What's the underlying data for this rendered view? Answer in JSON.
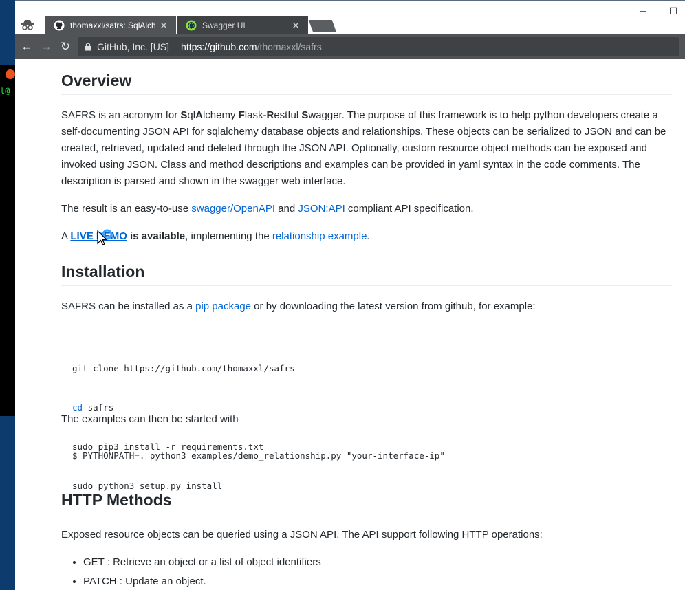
{
  "tabs": [
    {
      "title": "thomaxxl/safrs: SqlAlchem",
      "active": true,
      "icon": "github-icon"
    },
    {
      "title": "Swagger UI",
      "active": false,
      "icon": "swagger-icon"
    }
  ],
  "address": {
    "security_label": "GitHub, Inc. [US]",
    "scheme_host": "https://github.com",
    "path": "/thomaxxl/safrs"
  },
  "overview": {
    "heading": "Overview",
    "para1": [
      {
        "t": "SAFRS is an acronym for "
      },
      {
        "t": "S",
        "b": true
      },
      {
        "t": "ql"
      },
      {
        "t": "A",
        "b": true
      },
      {
        "t": "lchemy "
      },
      {
        "t": "F",
        "b": true
      },
      {
        "t": "lask-"
      },
      {
        "t": "R",
        "b": true
      },
      {
        "t": "estful "
      },
      {
        "t": "S",
        "b": true
      },
      {
        "t": "wagger. The purpose of this framework is to help python developers create a self-documenting JSON API for sqlalchemy database objects and relationships. These objects can be serialized to JSON and can be created, retrieved, updated and deleted through the JSON API. Optionally, custom resource object methods can be exposed and invoked using JSON. Class and method descriptions and examples can be provided in yaml syntax in the code comments. The description is parsed and shown in the swagger web interface."
      }
    ],
    "para2": [
      {
        "t": "The result is an easy-to-use "
      },
      {
        "t": "swagger/OpenAPI",
        "link": true
      },
      {
        "t": " and "
      },
      {
        "t": "JSON:API",
        "link": true
      },
      {
        "t": " compliant API specification."
      }
    ],
    "para3": [
      {
        "t": "A "
      },
      {
        "t": "LIVE DEMO",
        "link": true,
        "b": true,
        "u": true
      },
      {
        "t": " is available",
        "b": true
      },
      {
        "t": ", implementing the "
      },
      {
        "t": "relationship example",
        "link": true
      },
      {
        "t": "."
      }
    ]
  },
  "installation": {
    "heading": "Installation",
    "para": [
      {
        "t": "SAFRS can be installed as a "
      },
      {
        "t": "pip package",
        "link": true
      },
      {
        "t": " or by downloading the latest version from github, for example:"
      }
    ],
    "code_lines": [
      [
        "git clone https://github.com/thomaxxl/safrs"
      ],
      [
        "cd",
        " safrs"
      ],
      [
        "sudo pip3 install -r requirements.txt"
      ],
      [
        "sudo python3 setup.py install"
      ]
    ],
    "examples_text": "The examples can then be started with",
    "example_cmd": "$ PYTHONPATH=. python3 examples/demo_relationship.py \"your-interface-ip\""
  },
  "http": {
    "heading": "HTTP Methods",
    "para": "Exposed resource objects can be queried using a JSON API. The API support following HTTP operations:",
    "items": [
      "GET : Retrieve an object or a list of object identifiers",
      "PATCH : Update an object."
    ]
  },
  "colors": {
    "link": "#0366d6",
    "tab_active": "#505457",
    "toolbar": "#505457"
  }
}
